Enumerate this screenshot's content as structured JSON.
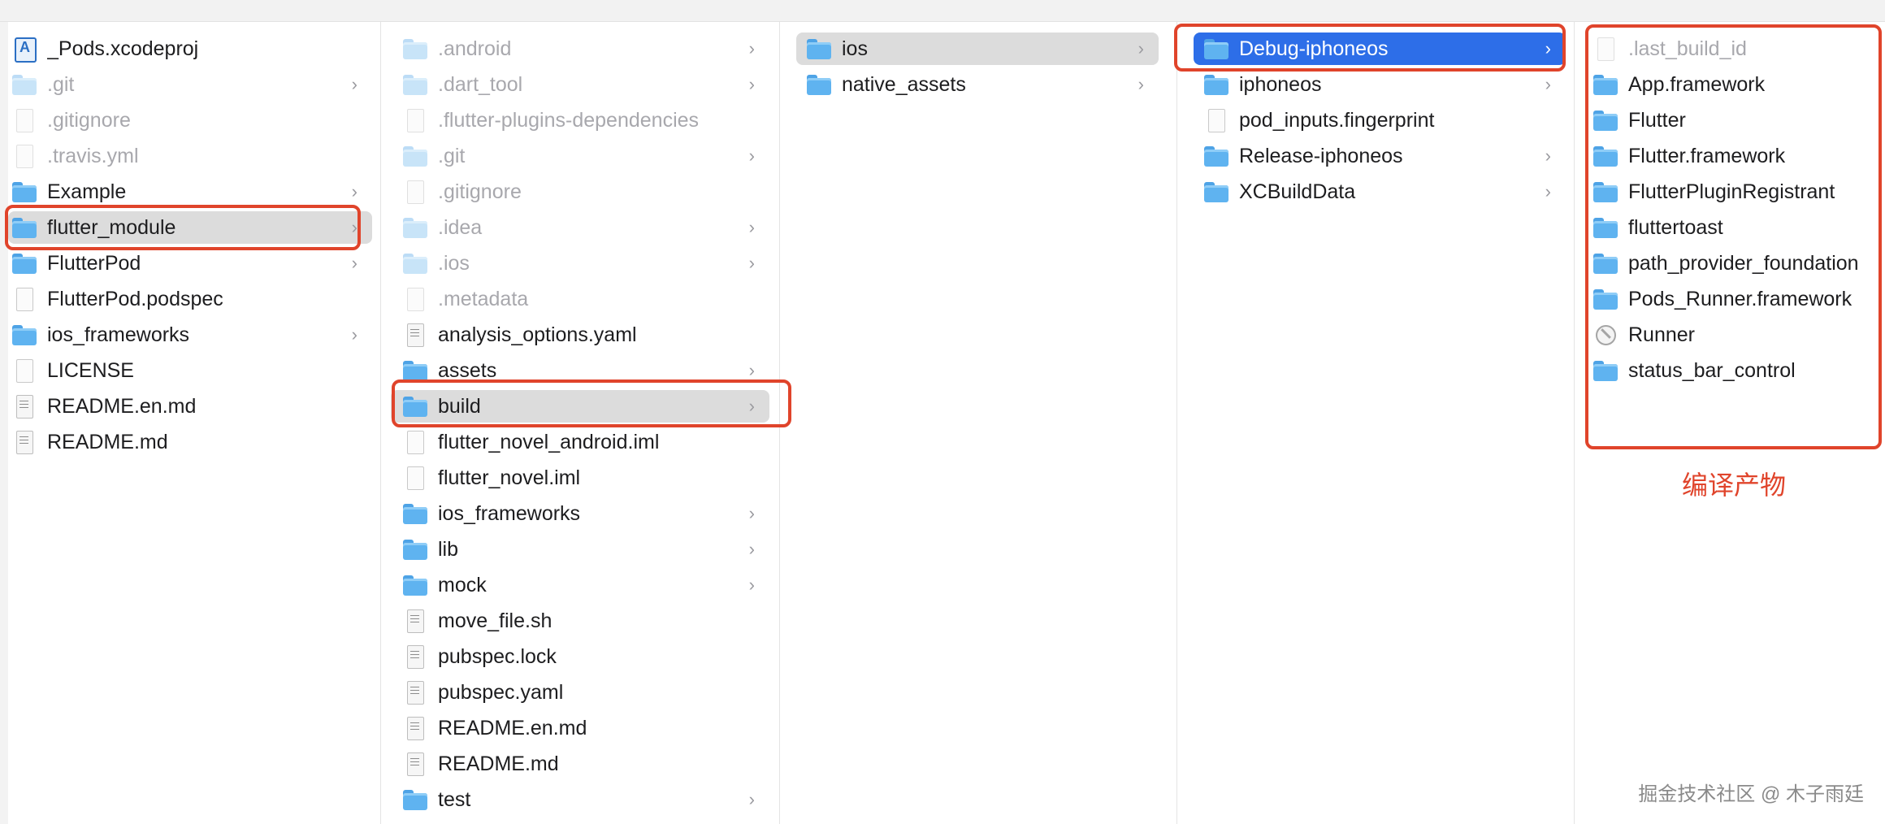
{
  "columns": [
    {
      "rows": [
        {
          "name": "_Pods.xcodeproj",
          "icon": "xcodeproj",
          "dim": false,
          "chevron": false,
          "selected": ""
        },
        {
          "name": ".git",
          "icon": "folder",
          "dim": true,
          "chevron": true,
          "selected": ""
        },
        {
          "name": ".gitignore",
          "icon": "file",
          "dim": true,
          "chevron": false,
          "selected": ""
        },
        {
          "name": ".travis.yml",
          "icon": "file",
          "dim": true,
          "chevron": false,
          "selected": ""
        },
        {
          "name": "Example",
          "icon": "folder",
          "dim": false,
          "chevron": true,
          "selected": ""
        },
        {
          "name": "flutter_module",
          "icon": "folder",
          "dim": false,
          "chevron": true,
          "selected": "gray"
        },
        {
          "name": "FlutterPod",
          "icon": "folder",
          "dim": false,
          "chevron": true,
          "selected": ""
        },
        {
          "name": "FlutterPod.podspec",
          "icon": "file",
          "dim": false,
          "chevron": false,
          "selected": ""
        },
        {
          "name": "ios_frameworks",
          "icon": "folder",
          "dim": false,
          "chevron": true,
          "selected": ""
        },
        {
          "name": "LICENSE",
          "icon": "file",
          "dim": false,
          "chevron": false,
          "selected": ""
        },
        {
          "name": "README.en.md",
          "icon": "text",
          "dim": false,
          "chevron": false,
          "selected": ""
        },
        {
          "name": "README.md",
          "icon": "text",
          "dim": false,
          "chevron": false,
          "selected": ""
        }
      ]
    },
    {
      "rows": [
        {
          "name": ".android",
          "icon": "folder",
          "dim": true,
          "chevron": true,
          "selected": ""
        },
        {
          "name": ".dart_tool",
          "icon": "folder",
          "dim": true,
          "chevron": true,
          "selected": ""
        },
        {
          "name": ".flutter-plugins-dependencies",
          "icon": "file",
          "dim": true,
          "chevron": false,
          "selected": ""
        },
        {
          "name": ".git",
          "icon": "folder",
          "dim": true,
          "chevron": true,
          "selected": ""
        },
        {
          "name": ".gitignore",
          "icon": "file",
          "dim": true,
          "chevron": false,
          "selected": ""
        },
        {
          "name": ".idea",
          "icon": "folder",
          "dim": true,
          "chevron": true,
          "selected": ""
        },
        {
          "name": ".ios",
          "icon": "folder",
          "dim": true,
          "chevron": true,
          "selected": ""
        },
        {
          "name": ".metadata",
          "icon": "file",
          "dim": true,
          "chevron": false,
          "selected": ""
        },
        {
          "name": "analysis_options.yaml",
          "icon": "text",
          "dim": false,
          "chevron": false,
          "selected": ""
        },
        {
          "name": "assets",
          "icon": "folder",
          "dim": false,
          "chevron": true,
          "selected": ""
        },
        {
          "name": "build",
          "icon": "folder",
          "dim": false,
          "chevron": true,
          "selected": "gray"
        },
        {
          "name": "flutter_novel_android.iml",
          "icon": "file",
          "dim": false,
          "chevron": false,
          "selected": ""
        },
        {
          "name": "flutter_novel.iml",
          "icon": "file",
          "dim": false,
          "chevron": false,
          "selected": ""
        },
        {
          "name": "ios_frameworks",
          "icon": "folder",
          "dim": false,
          "chevron": true,
          "selected": ""
        },
        {
          "name": "lib",
          "icon": "folder",
          "dim": false,
          "chevron": true,
          "selected": ""
        },
        {
          "name": "mock",
          "icon": "folder",
          "dim": false,
          "chevron": true,
          "selected": ""
        },
        {
          "name": "move_file.sh",
          "icon": "text",
          "dim": false,
          "chevron": false,
          "selected": ""
        },
        {
          "name": "pubspec.lock",
          "icon": "text",
          "dim": false,
          "chevron": false,
          "selected": ""
        },
        {
          "name": "pubspec.yaml",
          "icon": "text",
          "dim": false,
          "chevron": false,
          "selected": ""
        },
        {
          "name": "README.en.md",
          "icon": "text",
          "dim": false,
          "chevron": false,
          "selected": ""
        },
        {
          "name": "README.md",
          "icon": "text",
          "dim": false,
          "chevron": false,
          "selected": ""
        },
        {
          "name": "test",
          "icon": "folder",
          "dim": false,
          "chevron": true,
          "selected": ""
        }
      ]
    },
    {
      "rows": [
        {
          "name": "ios",
          "icon": "folder",
          "dim": false,
          "chevron": true,
          "selected": "gray"
        },
        {
          "name": "native_assets",
          "icon": "folder",
          "dim": false,
          "chevron": true,
          "selected": ""
        }
      ]
    },
    {
      "rows": [
        {
          "name": "Debug-iphoneos",
          "icon": "folder",
          "dim": false,
          "chevron": true,
          "selected": "blue"
        },
        {
          "name": "iphoneos",
          "icon": "folder",
          "dim": false,
          "chevron": true,
          "selected": ""
        },
        {
          "name": "pod_inputs.fingerprint",
          "icon": "file",
          "dim": false,
          "chevron": false,
          "selected": ""
        },
        {
          "name": "Release-iphoneos",
          "icon": "folder",
          "dim": false,
          "chevron": true,
          "selected": ""
        },
        {
          "name": "XCBuildData",
          "icon": "folder",
          "dim": false,
          "chevron": true,
          "selected": ""
        }
      ]
    },
    {
      "rows": [
        {
          "name": ".last_build_id",
          "icon": "file",
          "dim": true,
          "chevron": false,
          "selected": ""
        },
        {
          "name": "App.framework",
          "icon": "folder",
          "dim": false,
          "chevron": false,
          "selected": ""
        },
        {
          "name": "Flutter",
          "icon": "folder",
          "dim": false,
          "chevron": false,
          "selected": ""
        },
        {
          "name": "Flutter.framework",
          "icon": "folder",
          "dim": false,
          "chevron": false,
          "selected": ""
        },
        {
          "name": "FlutterPluginRegistrant",
          "icon": "folder",
          "dim": false,
          "chevron": false,
          "selected": ""
        },
        {
          "name": "fluttertoast",
          "icon": "folder",
          "dim": false,
          "chevron": false,
          "selected": ""
        },
        {
          "name": "path_provider_foundation",
          "icon": "folder",
          "dim": false,
          "chevron": false,
          "selected": ""
        },
        {
          "name": "Pods_Runner.framework",
          "icon": "folder",
          "dim": false,
          "chevron": false,
          "selected": ""
        },
        {
          "name": "Runner",
          "icon": "exec",
          "dim": false,
          "chevron": false,
          "selected": ""
        },
        {
          "name": "status_bar_control",
          "icon": "folder",
          "dim": false,
          "chevron": false,
          "selected": ""
        }
      ]
    }
  ],
  "annotation": "编译产物",
  "watermark": "掘金技术社区 @ 木子雨廷",
  "colors": {
    "highlight_box": "#e0442b",
    "selection_blue": "#2d6ee8",
    "selection_gray": "#dcdcdc"
  }
}
